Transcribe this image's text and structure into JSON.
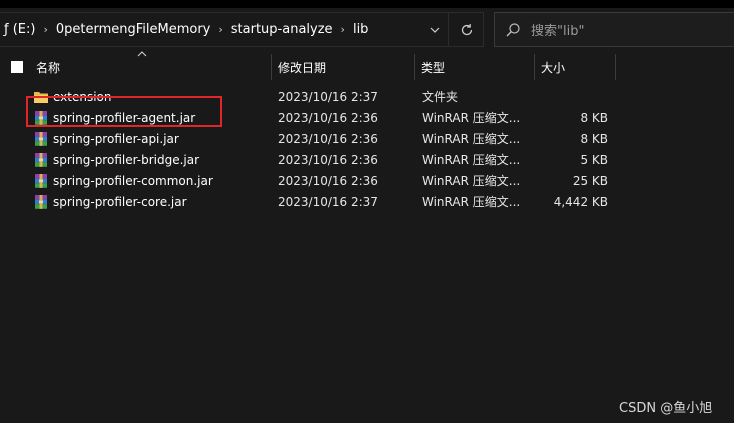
{
  "window": {
    "address": {
      "drive_crumb": "ƒ (E:)",
      "crumbs": [
        "0petermengFileMemory",
        "startup-analyze",
        "lib"
      ],
      "separator": "›"
    },
    "search": {
      "placeholder": "搜索\"lib\""
    }
  },
  "columns": {
    "name": "名称",
    "date": "修改日期",
    "type": "类型",
    "size": "大小"
  },
  "files": [
    {
      "name": "extension",
      "date": "2023/10/16 2:37",
      "type": "文件夹",
      "size": "",
      "icon": "folder-icon"
    },
    {
      "name": "spring-profiler-agent.jar",
      "date": "2023/10/16 2:36",
      "type": "WinRAR 压缩文...",
      "size": "8 KB",
      "icon": "winrar-archive-icon"
    },
    {
      "name": "spring-profiler-api.jar",
      "date": "2023/10/16 2:36",
      "type": "WinRAR 压缩文...",
      "size": "8 KB",
      "icon": "winrar-archive-icon"
    },
    {
      "name": "spring-profiler-bridge.jar",
      "date": "2023/10/16 2:36",
      "type": "WinRAR 压缩文...",
      "size": "5 KB",
      "icon": "winrar-archive-icon"
    },
    {
      "name": "spring-profiler-common.jar",
      "date": "2023/10/16 2:36",
      "type": "WinRAR 压缩文...",
      "size": "25 KB",
      "icon": "winrar-archive-icon"
    },
    {
      "name": "spring-profiler-core.jar",
      "date": "2023/10/16 2:37",
      "type": "WinRAR 压缩文...",
      "size": "4,442 KB",
      "icon": "winrar-archive-icon"
    }
  ],
  "watermark": "CSDN @鱼小旭",
  "colors": {
    "background": "#191919",
    "highlight_box": "#e0262b",
    "folder": "#e8b84a"
  }
}
